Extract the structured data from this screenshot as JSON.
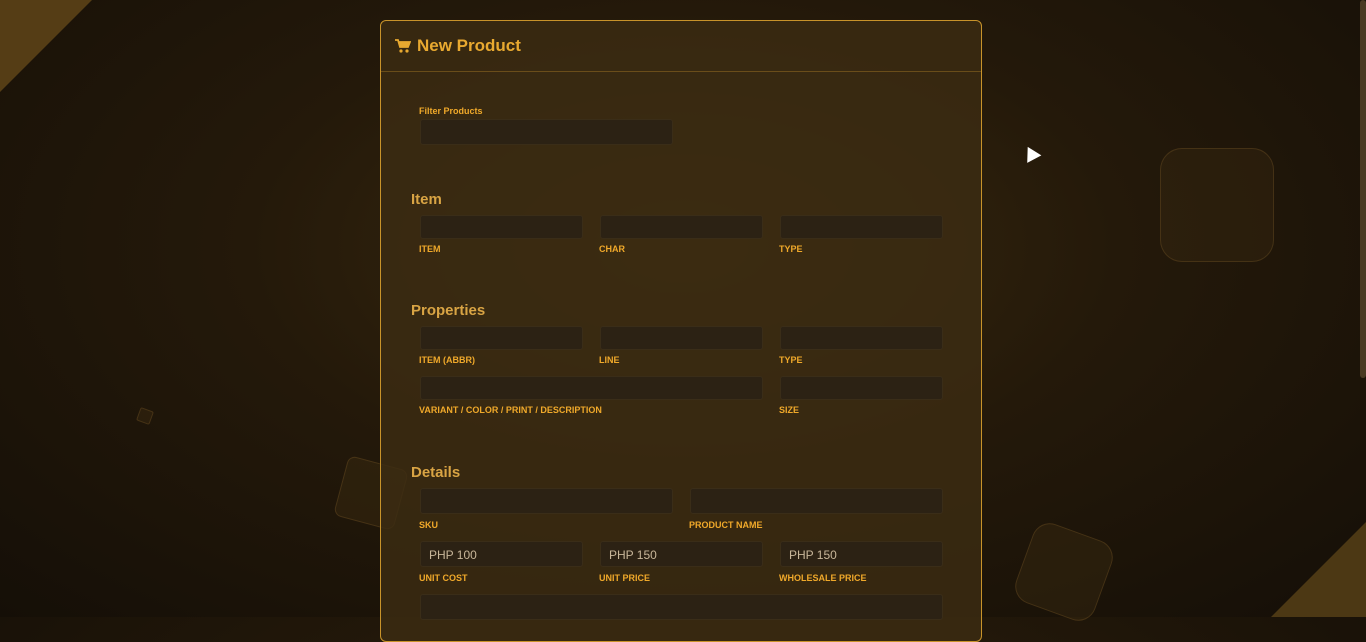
{
  "form": {
    "title": "New Product",
    "filter_label": "Filter Products",
    "sections": {
      "item": "Item",
      "properties": "Properties",
      "details": "Details"
    },
    "labels": {
      "item": "ITEM",
      "char": "CHAR",
      "type": "TYPE",
      "item_abbr": "ITEM (ABBR)",
      "line": "LINE",
      "type2": "TYPE",
      "variant": "VARIANT / COLOR / PRINT / DESCRIPTION",
      "size": "SIZE",
      "sku": "SKU",
      "product_name": "PRODUCT NAME",
      "unit_cost": "UNIT COST",
      "unit_price": "UNIT PRICE",
      "wholesale_price": "WHOLESALE PRICE"
    },
    "values": {
      "unit_cost": "PHP 100",
      "unit_price": "PHP 150",
      "wholesale_price": "PHP 150"
    }
  },
  "colors": {
    "accent": "#e8a930",
    "border": "#c8932a",
    "input_bg": "#2c2214"
  },
  "icons": {
    "title_icon": "cart-icon"
  }
}
